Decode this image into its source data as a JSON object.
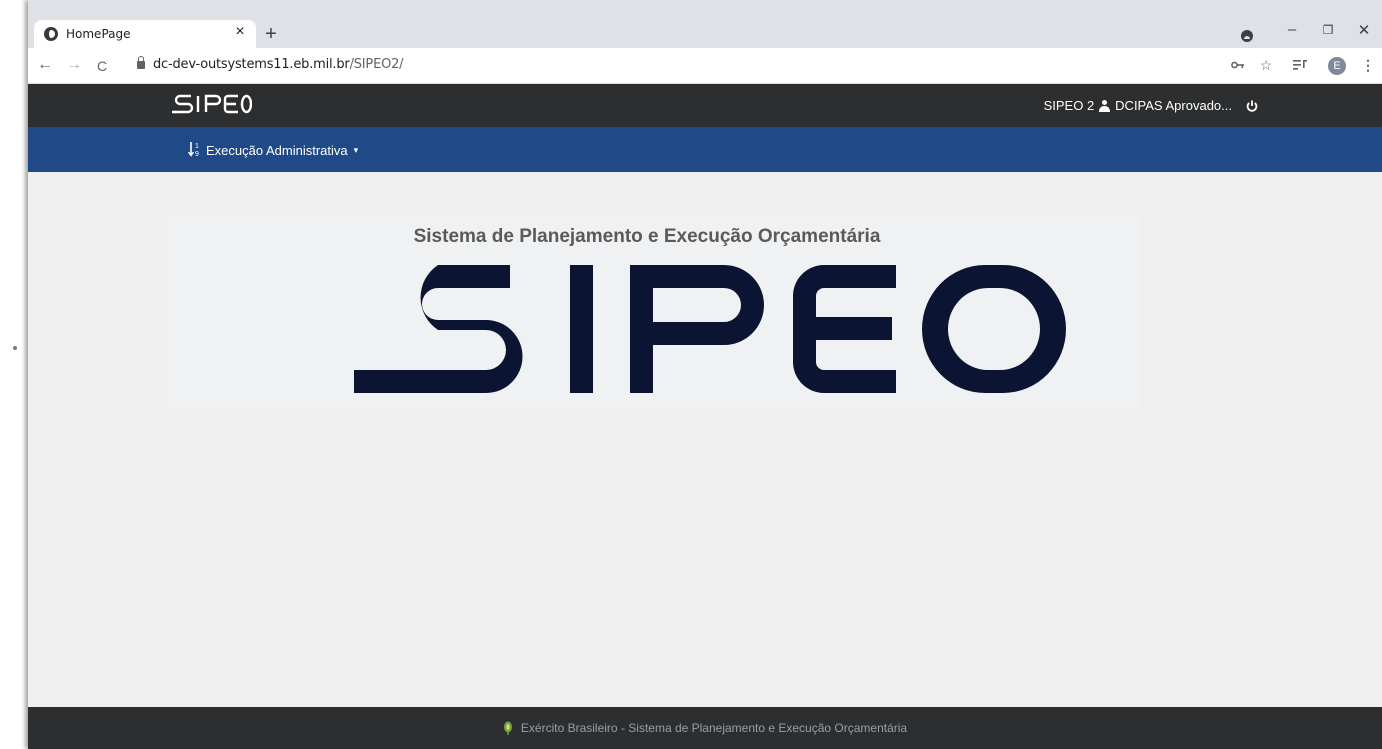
{
  "browser": {
    "tab_title": "HomePage",
    "tab_close": "×",
    "new_tab": "+",
    "url_domain": "dc-dev-outsystems11.eb.mil.br",
    "url_path": "/SIPEO2/",
    "back": "←",
    "forward": "→",
    "reload": "C",
    "avatar_letter": "E",
    "window_controls": [
      "–",
      "❐",
      "✕"
    ],
    "icons": [
      "key-icon",
      "star-icon",
      "reading-list-icon",
      "menu-icon"
    ]
  },
  "header": {
    "brand": "SIPEO",
    "app_name": "SIPEO 2",
    "user": "DCIPAS Aprovado..."
  },
  "menu": {
    "item_label": "Execução Administrativa",
    "item_icon": "sort-numeric-icon"
  },
  "hero": {
    "subtitle": "Sistema de Planejamento e Execução Orçamentária",
    "logo_text": "SIPEO"
  },
  "footer": {
    "text": "Exército Brasileiro - Sistema de Planejamento e Execução Orçamentária"
  },
  "colors": {
    "header_bg": "#2d2e30",
    "menubar_bg": "#1f4a87",
    "logo_navy": "#0b1533",
    "footer_text": "#9a9ea3",
    "leaf_green": "#6aa84f"
  }
}
